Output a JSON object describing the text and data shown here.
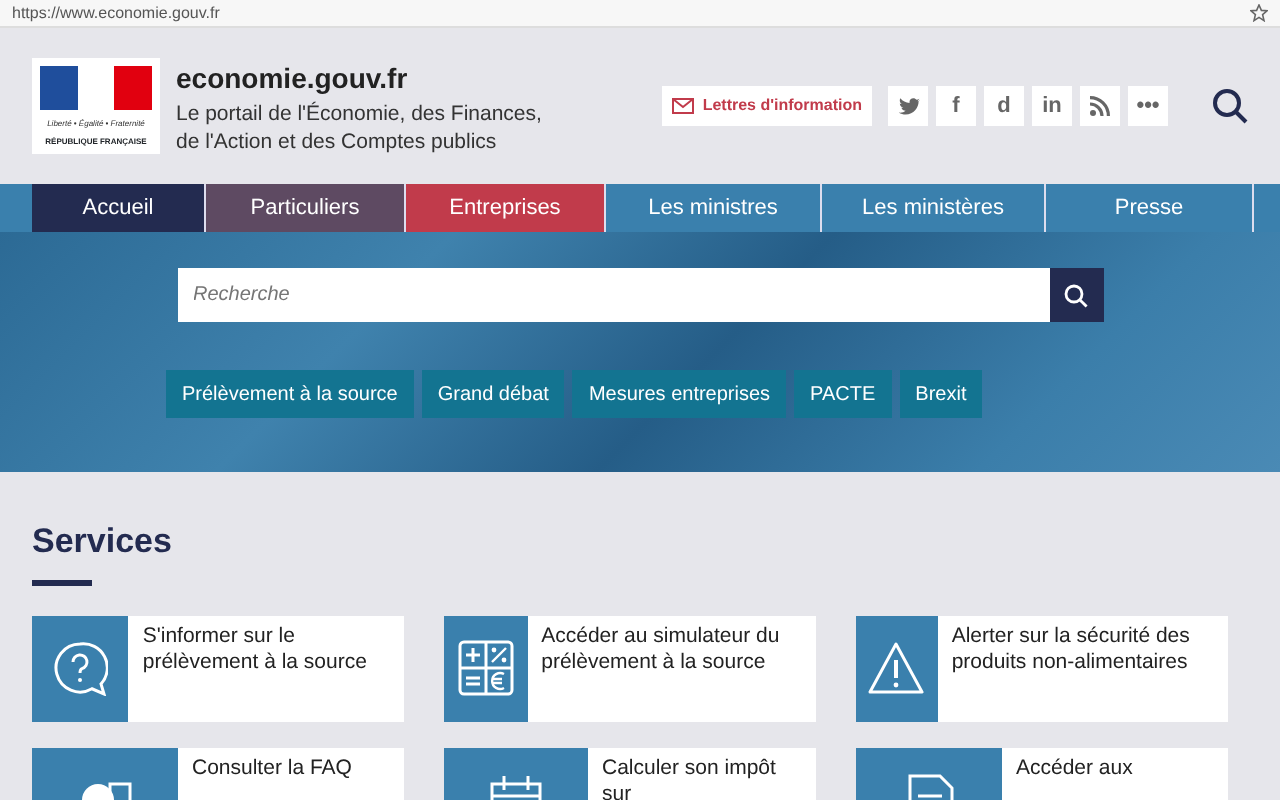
{
  "browser": {
    "url": "https://www.economie.gouv.fr"
  },
  "header": {
    "logo": {
      "motto": "Liberté • Égalité • Fraternité",
      "republic": "RÉPUBLIQUE FRANÇAISE"
    },
    "site_name": "economie.gouv.fr",
    "tagline_lines": [
      "Le portail de l'Économie, des Finances,",
      "de l'Action et des Comptes publics"
    ],
    "newsletter": "Lettres d'information",
    "social": [
      {
        "kind": "bird"
      },
      {
        "kind": "text",
        "label": "f"
      },
      {
        "kind": "text",
        "label": "d"
      },
      {
        "kind": "text",
        "label": "in"
      },
      {
        "kind": "rss"
      },
      {
        "kind": "text",
        "label": "•••"
      }
    ]
  },
  "nav": [
    {
      "label": "Accueil",
      "color": "#232b50"
    },
    {
      "label": "Particuliers",
      "color": "#5e4a62"
    },
    {
      "label": "Entreprises",
      "color": "#c13b4b"
    },
    {
      "label": "Les ministres",
      "color": "#3a80ad"
    },
    {
      "label": "Les ministères",
      "color": "#3a80ad"
    },
    {
      "label": "Presse",
      "color": "#3a80ad"
    }
  ],
  "hero": {
    "search": {
      "placeholder": "Recherche"
    },
    "quick_links": [
      "Prélèvement à la source",
      "Grand débat",
      "Mesures entreprises",
      "PACTE",
      "Brexit"
    ]
  },
  "services": {
    "title": "Services",
    "cards": [
      {
        "kind": "question",
        "text": "S'informer sur le prélèvement à la source"
      },
      {
        "kind": "calculator",
        "text": "Accéder au simulateur du prélèvement à la source"
      },
      {
        "kind": "warning",
        "text": "Alerter sur la sécurité des produits non-alimentaires"
      },
      {
        "kind": "faq",
        "text": "Consulter la FAQ"
      },
      {
        "kind": "calendar",
        "text": "Calculer son impôt sur"
      },
      {
        "kind": "document",
        "text": "Accéder aux"
      }
    ]
  }
}
